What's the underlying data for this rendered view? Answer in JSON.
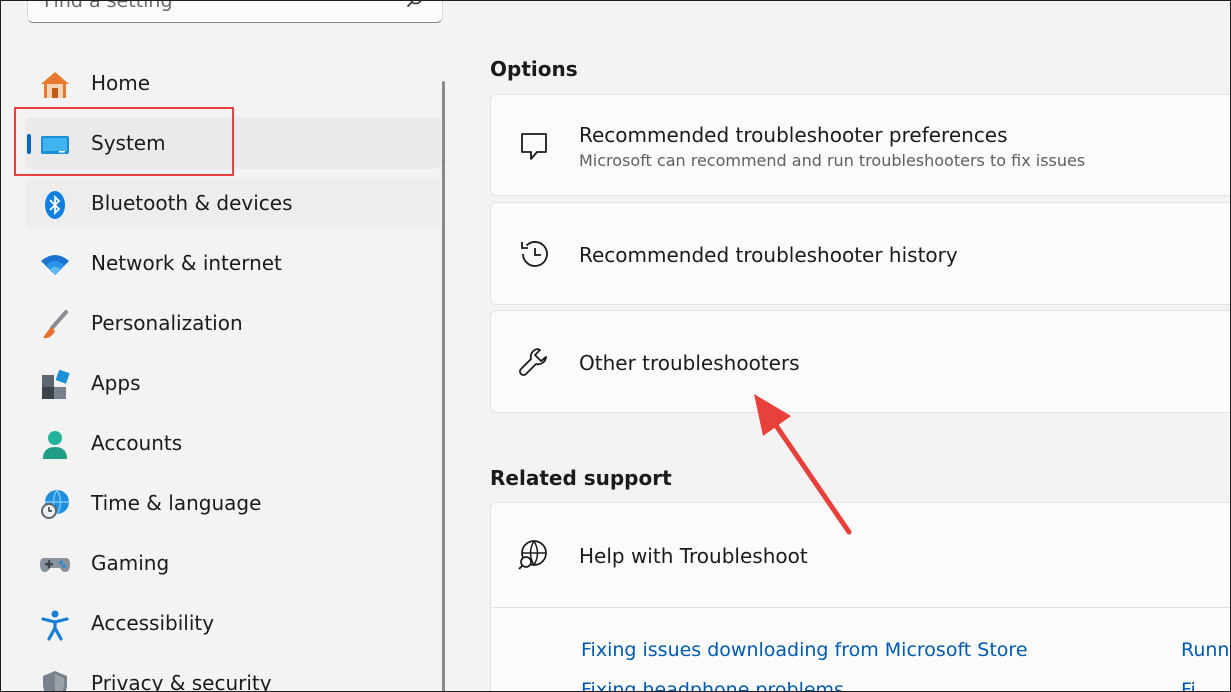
{
  "search": {
    "placeholder": "Find a setting"
  },
  "sidebar": {
    "items": [
      {
        "label": "Home",
        "icon": "home-icon"
      },
      {
        "label": "System",
        "icon": "system-display-icon"
      },
      {
        "label": "Bluetooth & devices",
        "icon": "bluetooth-icon"
      },
      {
        "label": "Network & internet",
        "icon": "wifi-icon"
      },
      {
        "label": "Personalization",
        "icon": "brush-icon"
      },
      {
        "label": "Apps",
        "icon": "apps-icon"
      },
      {
        "label": "Accounts",
        "icon": "person-icon"
      },
      {
        "label": "Time & language",
        "icon": "globe-clock-icon"
      },
      {
        "label": "Gaming",
        "icon": "gamepad-icon"
      },
      {
        "label": "Accessibility",
        "icon": "accessibility-icon"
      },
      {
        "label": "Privacy & security",
        "icon": "shield-icon"
      }
    ],
    "selected": "System"
  },
  "options": {
    "title": "Options",
    "cards": [
      {
        "title": "Recommended troubleshooter preferences",
        "subtitle": "Microsoft can recommend and run troubleshooters to fix issues",
        "icon": "chat-bubble-icon"
      },
      {
        "title": "Recommended troubleshooter history",
        "icon": "history-icon"
      },
      {
        "title": "Other troubleshooters",
        "icon": "wrench-icon"
      }
    ]
  },
  "related_support": {
    "title": "Related support",
    "card": {
      "title": "Help with Troubleshoot",
      "icon": "web-search-icon"
    },
    "links": [
      "Fixing issues downloading from Microsoft Store",
      "Runn",
      "Fixing headphone problems",
      "Fi"
    ]
  },
  "colors": {
    "accent": "#0067c0",
    "link": "#0059b3",
    "annotation": "#e8403a"
  }
}
